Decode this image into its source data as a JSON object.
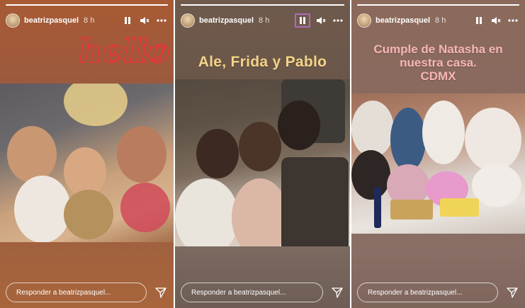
{
  "stories": [
    {
      "username": "beatrizpasquel",
      "time": "8 h",
      "overlay_text": "hello",
      "overlay_color": "#e8343c",
      "reply_placeholder": "Responder a beatrizpasquel...",
      "progress": 1.0
    },
    {
      "username": "beatrizpasquel",
      "time": "8 h",
      "overlay_text": "Ale, Frida y Pablo",
      "overlay_color": "#f4d487",
      "reply_placeholder": "Responder a beatrizpasquel...",
      "progress": 1.0,
      "pause_highlighted": true
    },
    {
      "username": "beatrizpasquel",
      "time": "8 h",
      "overlay_lines": [
        "Cumple de Natasha en",
        "nuestra casa.",
        "CDMX"
      ],
      "overlay_color": "#f7b6b6",
      "reply_placeholder": "Responder a beatrizpasquel...",
      "progress": 1.0
    }
  ],
  "icons": {
    "pause": "pause-icon",
    "mute": "volume-mute-icon",
    "more": "more-options-icon",
    "send": "send-icon",
    "avatar": "avatar"
  }
}
